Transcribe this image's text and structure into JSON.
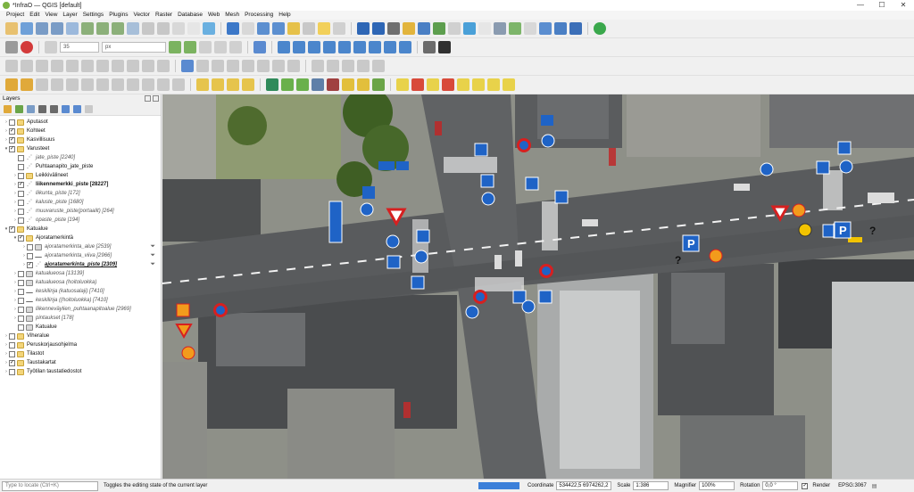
{
  "window": {
    "title": "*InfraO — QGIS [default]",
    "minimize": "—",
    "maximize": "☐",
    "close": "✕"
  },
  "menu": [
    "Project",
    "Edit",
    "View",
    "Layer",
    "Settings",
    "Plugins",
    "Vector",
    "Raster",
    "Database",
    "Web",
    "Mesh",
    "Processing",
    "Help"
  ],
  "toolbar": {
    "font_size_value": "35",
    "font_size_unit": "px"
  },
  "layers_panel": {
    "title": "Layers",
    "items": [
      {
        "label": "Aputasot",
        "checked": false,
        "expanded": false,
        "depth": 0,
        "type": "group",
        "style": ""
      },
      {
        "label": "Kohteet",
        "checked": true,
        "expanded": false,
        "depth": 0,
        "type": "group",
        "style": ""
      },
      {
        "label": "Kasvillisuus",
        "checked": true,
        "expanded": false,
        "depth": 0,
        "type": "group",
        "style": ""
      },
      {
        "label": "Varusteet",
        "checked": true,
        "expanded": true,
        "depth": 0,
        "type": "group",
        "style": ""
      },
      {
        "label": "jate_piste [2240]",
        "checked": false,
        "expanded": null,
        "depth": 1,
        "type": "point",
        "style": "italic"
      },
      {
        "label": "Puhtaanapito_jate_piste",
        "checked": false,
        "expanded": null,
        "depth": 1,
        "type": "point",
        "style": ""
      },
      {
        "label": "Leikkivälineet",
        "checked": false,
        "expanded": false,
        "depth": 1,
        "type": "group",
        "style": ""
      },
      {
        "label": "liikennemerkki_piste [28227]",
        "checked": true,
        "expanded": false,
        "depth": 1,
        "type": "point",
        "style": "bold"
      },
      {
        "label": "liikunta_piste [172]",
        "checked": false,
        "expanded": false,
        "depth": 1,
        "type": "point",
        "style": "italic"
      },
      {
        "label": "kaluste_piste [1680]",
        "checked": false,
        "expanded": false,
        "depth": 1,
        "type": "point",
        "style": "italic"
      },
      {
        "label": "muuvaruste_piste(portaalit) [264]",
        "checked": false,
        "expanded": false,
        "depth": 1,
        "type": "point",
        "style": "italic"
      },
      {
        "label": "opaste_piste [194]",
        "checked": false,
        "expanded": false,
        "depth": 1,
        "type": "point",
        "style": "italic"
      },
      {
        "label": "Katualue",
        "checked": true,
        "expanded": true,
        "depth": 0,
        "type": "group",
        "style": ""
      },
      {
        "label": "Ajoratamerkintä",
        "checked": true,
        "expanded": true,
        "depth": 1,
        "type": "group",
        "style": ""
      },
      {
        "label": "ajoratamerkinta_alue [2539]",
        "checked": false,
        "expanded": false,
        "depth": 2,
        "type": "poly",
        "style": "italic",
        "filter": true
      },
      {
        "label": "ajoratamerkinta_viiva [2966]",
        "checked": false,
        "expanded": false,
        "depth": 2,
        "type": "line",
        "style": "italic",
        "filter": true
      },
      {
        "label": "ajoratamerkinta_piste [2309]",
        "checked": true,
        "expanded": false,
        "depth": 2,
        "type": "point",
        "style": "under",
        "filter": true
      },
      {
        "label": "katualueosa [13139]",
        "checked": false,
        "expanded": false,
        "depth": 1,
        "type": "poly",
        "style": "italic"
      },
      {
        "label": "katualueosa (hoitoluokka)",
        "checked": false,
        "expanded": false,
        "depth": 1,
        "type": "poly",
        "style": "italic"
      },
      {
        "label": "keskilinja (katuosalaji) [7410]",
        "checked": false,
        "expanded": false,
        "depth": 1,
        "type": "line",
        "style": "italic"
      },
      {
        "label": "keskilinja ((hoitoluokka) [7410]",
        "checked": false,
        "expanded": false,
        "depth": 1,
        "type": "line",
        "style": "italic"
      },
      {
        "label": "liikenneväylien_puhtaanapitoalue [2969]",
        "checked": false,
        "expanded": false,
        "depth": 1,
        "type": "poly",
        "style": "italic"
      },
      {
        "label": "pintaukset [178]",
        "checked": false,
        "expanded": false,
        "depth": 1,
        "type": "poly",
        "style": "italic"
      },
      {
        "label": "Katualue",
        "checked": false,
        "expanded": null,
        "depth": 1,
        "type": "poly",
        "style": ""
      },
      {
        "label": "Viheralue",
        "checked": false,
        "expanded": false,
        "depth": 0,
        "type": "group",
        "style": ""
      },
      {
        "label": "Peruskorjausohjelma",
        "checked": false,
        "expanded": false,
        "depth": 0,
        "type": "group",
        "style": ""
      },
      {
        "label": "Tilastot",
        "checked": false,
        "expanded": false,
        "depth": 0,
        "type": "group",
        "style": ""
      },
      {
        "label": "Taustakartat",
        "checked": true,
        "expanded": false,
        "depth": 0,
        "type": "group",
        "style": ""
      },
      {
        "label": "Työtilan taustatiedostot",
        "checked": false,
        "expanded": false,
        "depth": 0,
        "type": "group",
        "style": ""
      }
    ]
  },
  "map": {
    "question_marks": [
      "?",
      "?"
    ]
  },
  "statusbar": {
    "locate_placeholder": "Type to locate (Ctrl+K)",
    "message": "Toggles the editing state of the current layer",
    "coordinate_label": "Coordinate",
    "coordinate_value": "534422,5 6974262,2",
    "scale_label": "Scale",
    "scale_value": "1:386",
    "magnifier_label": "Magnifier",
    "magnifier_value": "100%",
    "rotation_label": "Rotation",
    "rotation_value": "0,0 °",
    "render_label": "Render",
    "crs_label": "EPSG:3067"
  },
  "colors": {
    "road": "#5c5e60",
    "roof": "#4f5153",
    "sign_blue": "#1f63c6",
    "sign_red": "#d62020",
    "sign_orange": "#f29b1c"
  }
}
